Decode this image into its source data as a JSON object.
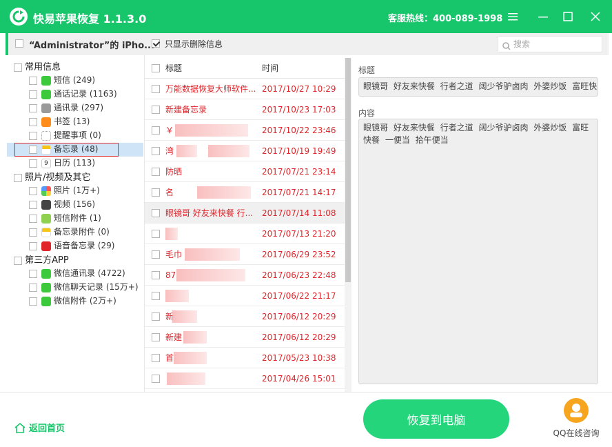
{
  "app": {
    "title": "快易苹果恢复 1.1.3.0",
    "hotline": "客服热线：400-089-1998"
  },
  "toolbar": {
    "device": "“Administrator”的 iPho...",
    "only_deleted": "只显示删除信息",
    "search_placeholder": "搜索"
  },
  "sidebar": {
    "groups": [
      {
        "label": "常用信息",
        "items": [
          {
            "label": "短信 (249)",
            "icon": "message-icon",
            "color": "#3cc93c"
          },
          {
            "label": "通话记录 (1163)",
            "icon": "phone-icon",
            "color": "#3cc93c"
          },
          {
            "label": "通讯录 (297)",
            "icon": "contacts-icon",
            "color": "#9a9a9a"
          },
          {
            "label": "书签 (13)",
            "icon": "bookmark-icon",
            "color": "#ff8c1a"
          },
          {
            "label": "提醒事项 (0)",
            "icon": "reminder-icon",
            "color": "#dddddd"
          },
          {
            "label": "备忘录 (48)",
            "icon": "notes-icon",
            "color": "#f5c518"
          },
          {
            "label": "日历 (113)",
            "icon": "calendar-icon",
            "color": "#e0252b"
          }
        ]
      },
      {
        "label": "照片/视频及其它",
        "items": [
          {
            "label": "照片 (1万+)",
            "icon": "photos-icon",
            "color": "#f58ab0"
          },
          {
            "label": "视频 (156)",
            "icon": "video-icon",
            "color": "#444444"
          },
          {
            "label": "短信附件 (1)",
            "icon": "attachment-icon",
            "color": "#8fd14f"
          },
          {
            "label": "备忘录附件 (0)",
            "icon": "notes-attachment-icon",
            "color": "#f5c518"
          },
          {
            "label": "语音备忘录 (29)",
            "icon": "voice-memo-icon",
            "color": "#e0252b"
          }
        ]
      },
      {
        "label": "第三方APP",
        "items": [
          {
            "label": "微信通讯录 (4722)",
            "icon": "wechat-icon",
            "color": "#3cc93c"
          },
          {
            "label": "微信聊天记录 (15万+)",
            "icon": "wechat-icon",
            "color": "#3cc93c"
          },
          {
            "label": "微信附件 (2万+)",
            "icon": "wechat-icon",
            "color": "#3cc93c"
          }
        ]
      }
    ]
  },
  "list": {
    "col_title": "标题",
    "col_time": "时间",
    "rows": [
      {
        "title": "万能数据恢复大师软件...",
        "time": "2017/10/27 10:29"
      },
      {
        "title": "新建备忘录",
        "time": "2017/10/23 17:03"
      },
      {
        "title": "￥",
        "time": "2017/10/22 23:46"
      },
      {
        "title": "湾",
        "time": "2017/10/19 19:49"
      },
      {
        "title": "防晒",
        "time": "2017/07/21 23:14"
      },
      {
        "title": "名",
        "time": "2017/07/21 14:17"
      },
      {
        "title": "眼镜哥  好友来快餐  行...",
        "time": "2017/07/14 11:08"
      },
      {
        "title": "",
        "time": "2017/07/13 21:20"
      },
      {
        "title": "毛巾",
        "time": "2017/06/29 23:52"
      },
      {
        "title": "87",
        "time": "2017/06/23 22:48"
      },
      {
        "title": "",
        "time": "2017/06/22 21:17"
      },
      {
        "title": "新",
        "time": "2017/06/12 20:29"
      },
      {
        "title": "新建",
        "time": "2017/06/12 20:29"
      },
      {
        "title": "首",
        "time": "2017/05/23 10:38"
      },
      {
        "title": "",
        "time": "2017/04/26 15:01"
      }
    ]
  },
  "detail": {
    "title_label": "标题",
    "title_value": "眼镜哥 好友来快餐 行者之道 阔少爷驴卤肉 外婆炒饭 富旺快",
    "content_label": "内容",
    "content_value": "眼镜哥 好友来快餐 行者之道 阔少爷驴卤肉 外婆炒饭 富旺快餐 一便当 拾午便当"
  },
  "footer": {
    "home": "返回首页",
    "recover": "恢复到电脑",
    "qq": "QQ在线咨询"
  },
  "colors": {
    "brand": "#17c56a",
    "deleted": "#e0252b"
  }
}
